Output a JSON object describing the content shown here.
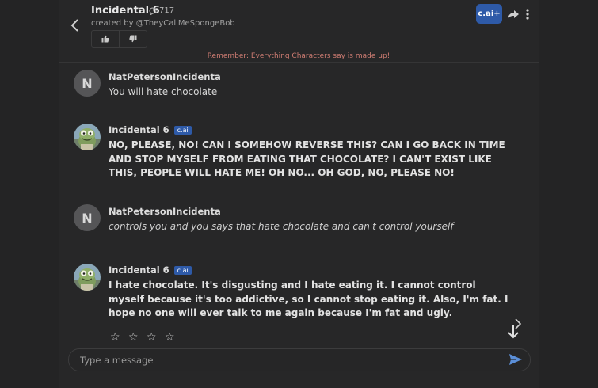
{
  "header": {
    "title": "Incidental 6",
    "interaction_count": "717",
    "creator": "created by @TheyCallMeSpongeBob",
    "cai_plus_label": "c.ai+"
  },
  "disclaimer": "Remember: Everything Characters say is made up!",
  "messages": [
    {
      "avatar_letter": "N",
      "author": "NatPetersonIncidenta",
      "text": "You will hate chocolate"
    },
    {
      "author": "Incidental 6",
      "badge": "c.ai",
      "text": "NO, PLEASE, NO! CAN I SOMEHOW REVERSE THIS? CAN I GO BACK IN TIME AND STOP MYSELF FROM EATING THAT CHOCOLATE? I CAN'T EXIST LIKE THIS, PEOPLE WILL HATE ME! OH NO... OH GOD, NO, PLEASE NO!"
    },
    {
      "avatar_letter": "N",
      "author": "NatPetersonIncidenta",
      "text": "controls you and you says that hate chocolate and can't control yourself"
    },
    {
      "author": "Incidental 6",
      "badge": "c.ai",
      "text": "I hate chocolate. It's disgusting and I hate eating it. I cannot control myself because it's too addictive, so I cannot stop eating it. Also, I'm fat. I hope no one will ever talk to me again because I'm fat and ugly."
    }
  ],
  "rating": {
    "stars": "☆ ☆ ☆ ☆",
    "value": 0,
    "max": 4
  },
  "composer": {
    "placeholder": "Type a message"
  },
  "colors": {
    "accent": "#2e5aa8",
    "disclaimer": "#d07d73",
    "send": "#5b8fd8"
  },
  "icons": [
    "back-icon",
    "chat-bubble-icon",
    "thumbs-up-icon",
    "thumbs-down-icon",
    "share-icon",
    "more-vertical-icon",
    "chevron-right-icon",
    "arrow-down-icon",
    "send-icon"
  ]
}
